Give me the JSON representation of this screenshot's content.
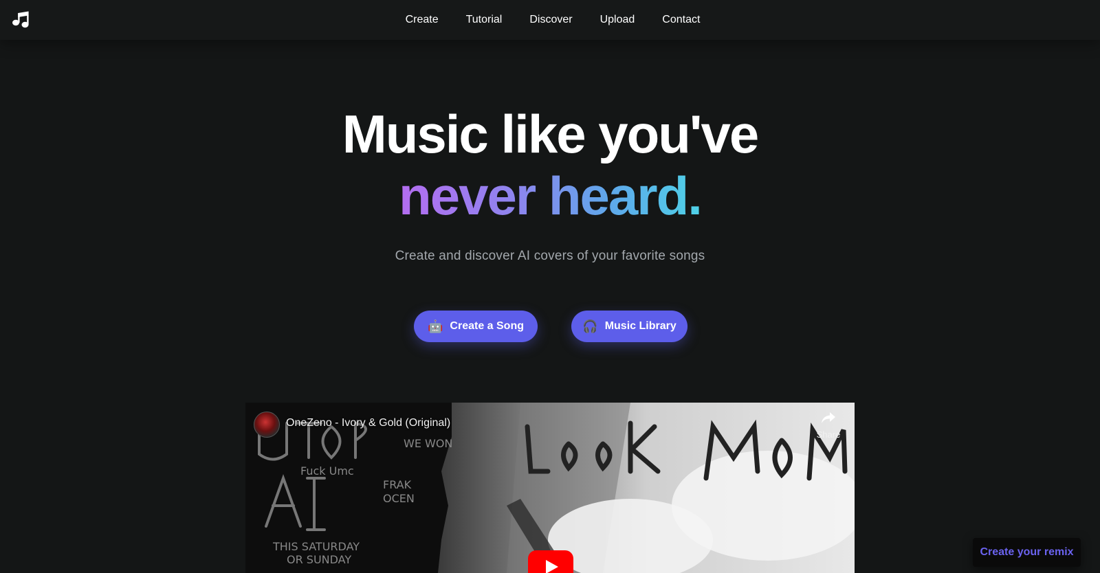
{
  "nav": {
    "items": [
      {
        "label": "Create"
      },
      {
        "label": "Tutorial"
      },
      {
        "label": "Discover"
      },
      {
        "label": "Upload"
      },
      {
        "label": "Contact"
      }
    ],
    "logo_icon": "music-note-icon"
  },
  "hero": {
    "headline_line1": "Music like you've",
    "headline_line2": "never heard.",
    "subtitle": "Create and discover AI covers of your favorite songs",
    "create_button": {
      "icon": "🤖",
      "label": "Create a Song"
    },
    "library_button": {
      "icon": "🎧",
      "label": "Music Library"
    }
  },
  "video": {
    "title": "OneZeno - Ivory & Gold (Original)",
    "share_label": "Share"
  },
  "remix_button": {
    "label": "Create your remix"
  },
  "colors": {
    "background": "#141616",
    "accent": "#5d5eea",
    "gradient_start": "#b46df0",
    "gradient_end": "#4fd2e8"
  }
}
